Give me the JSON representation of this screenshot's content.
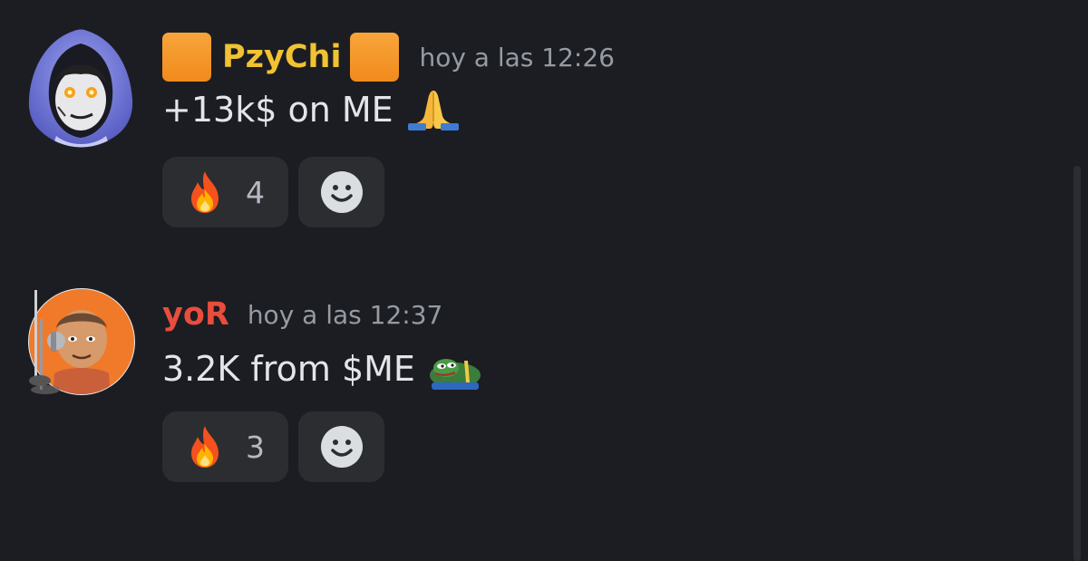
{
  "messages": [
    {
      "author": "PzyChi",
      "timestamp": "hoy a las 12:26",
      "content": "+13k$ on ME",
      "content_emoji": "folded-hands",
      "author_color": "#f1c232",
      "author_decoration": "orange-square",
      "reactions": [
        {
          "emoji": "fire",
          "count": "4"
        }
      ]
    },
    {
      "author": "yoR",
      "timestamp": "hoy a las 12:37",
      "content": "3.2K from $ME",
      "content_emoji": "pepe-praying",
      "author_color": "#e84d3d",
      "reactions": [
        {
          "emoji": "fire",
          "count": "3"
        }
      ]
    }
  ],
  "colors": {
    "background": "#1c1d22",
    "reaction_bg": "#2b2d31",
    "timestamp": "#949ba4"
  }
}
